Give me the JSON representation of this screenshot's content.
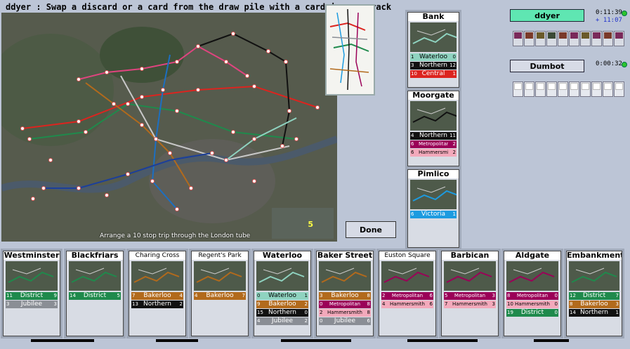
{
  "prompt": "ddyer : Swap a discard or a card from the draw pile with a card in your rack",
  "map": {
    "hint": "Arrange a 10 stop trip through the London tube",
    "count": "5"
  },
  "done_label": "Done",
  "players": [
    {
      "name": "ddyer",
      "time": "0:11:39",
      "extra": "+ 11:07",
      "active": true
    },
    {
      "name": "Dumbot",
      "time": "0:00:32",
      "active": false
    }
  ],
  "colors": {
    "District": "#1f8a4c",
    "Jubilee": "#8a8e95",
    "Bakerloo": "#b26a1c",
    "Northern": "#111111",
    "Central": "#dc241f",
    "Waterloo": "#8fd3c0",
    "Metropolitan": "#9b0058",
    "Hammersmith": "#f3a9bb",
    "Victoria": "#1c9be0"
  },
  "side_cards": [
    {
      "title": "Bank",
      "lines": [
        {
          "l": "1",
          "name": "Waterloo",
          "r": "0",
          "key": "Waterloo"
        },
        {
          "l": "3",
          "name": "Northern",
          "r": "12",
          "key": "Northern"
        },
        {
          "l": "10",
          "name": "Central",
          "r": "1",
          "key": "Central"
        }
      ]
    },
    {
      "title": "Moorgate",
      "lines": [
        {
          "l": "4",
          "name": "Northern",
          "r": "11",
          "key": "Northern"
        },
        {
          "l": "6",
          "name": "Metropolitan",
          "r": "2",
          "key": "Metropolitan"
        },
        {
          "l": "6",
          "name": "Hammersmith",
          "r": "2",
          "key": "Hammersmith"
        }
      ]
    },
    {
      "title": "Pimlico",
      "lines": [
        {
          "l": "6",
          "name": "Victoria",
          "r": "1",
          "key": "Victoria"
        }
      ]
    }
  ],
  "rack_cards": [
    {
      "title": "Westminster",
      "small": false,
      "lines": [
        {
          "l": "11",
          "name": "District",
          "r": "9",
          "key": "District"
        },
        {
          "l": "3",
          "name": "Jubilee",
          "r": "3",
          "key": "Jubilee"
        }
      ]
    },
    {
      "title": "Blackfriars",
      "small": false,
      "lines": [
        {
          "l": "14",
          "name": "District",
          "r": "5",
          "key": "District"
        }
      ]
    },
    {
      "title": "Charing Cross",
      "small": true,
      "lines": [
        {
          "l": "7",
          "name": "Bakerloo",
          "r": "4",
          "key": "Bakerloo"
        },
        {
          "l": "13",
          "name": "Northern",
          "r": "2",
          "key": "Northern"
        }
      ]
    },
    {
      "title": "Regent's Park",
      "small": true,
      "lines": [
        {
          "l": "4",
          "name": "Bakerloo",
          "r": "7",
          "key": "Bakerloo"
        }
      ]
    },
    {
      "title": "Waterloo",
      "small": false,
      "lines": [
        {
          "l": "0",
          "name": "Waterloo",
          "r": "1",
          "key": "Waterloo"
        },
        {
          "l": "9",
          "name": "Bakerloo",
          "r": "2",
          "key": "Bakerloo"
        },
        {
          "l": "15",
          "name": "Northern",
          "r": "0",
          "key": "Northern"
        },
        {
          "l": "4",
          "name": "Jubilee",
          "r": "2",
          "key": "Jubilee"
        }
      ]
    },
    {
      "title": "Baker Street",
      "small": false,
      "lines": [
        {
          "l": "3",
          "name": "Bakerloo",
          "r": "8",
          "key": "Bakerloo"
        },
        {
          "l": "0",
          "name": "Metropolitan",
          "r": "8",
          "key": "Metropolitan"
        },
        {
          "l": "2",
          "name": "Hammersmith",
          "r": "8",
          "key": "Hammersmith"
        },
        {
          "l": "0",
          "name": "Jubilee",
          "r": "6",
          "key": "Jubilee"
        }
      ]
    },
    {
      "title": "Euston Square",
      "small": true,
      "lines": [
        {
          "l": "2",
          "name": "Metropolitan",
          "r": "6",
          "key": "Metropolitan"
        },
        {
          "l": "4",
          "name": "Hammersmith",
          "r": "6",
          "key": "Hammersmith"
        }
      ]
    },
    {
      "title": "Barbican",
      "small": false,
      "lines": [
        {
          "l": "5",
          "name": "Metropolitan",
          "r": "3",
          "key": "Metropolitan"
        },
        {
          "l": "7",
          "name": "Hammersmith",
          "r": "3",
          "key": "Hammersmith"
        }
      ]
    },
    {
      "title": "Aldgate",
      "small": false,
      "lines": [
        {
          "l": "8",
          "name": "Metropolitan",
          "r": "0",
          "key": "Metropolitan"
        },
        {
          "l": "10",
          "name": "Hammersmith",
          "r": "0",
          "key": "Hammersmith"
        },
        {
          "l": "19",
          "name": "District",
          "r": "0",
          "key": "District"
        }
      ]
    },
    {
      "title": "Embankment",
      "small": false,
      "lines": [
        {
          "l": "12",
          "name": "District",
          "r": "7",
          "key": "District"
        },
        {
          "l": "8",
          "name": "Bakerloo",
          "r": "3",
          "key": "Bakerloo"
        },
        {
          "l": "14",
          "name": "Northern",
          "r": "1",
          "key": "Northern"
        }
      ]
    }
  ]
}
